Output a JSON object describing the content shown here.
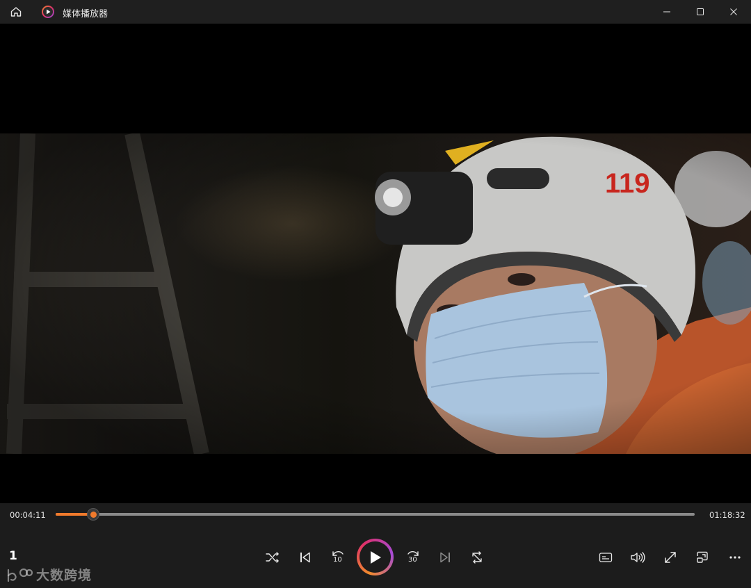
{
  "window": {
    "title": "媒体播放器",
    "home_icon": "home-icon",
    "app_icon": "media-player-icon",
    "minimize_icon": "minimize-icon",
    "maximize_icon": "maximize-icon",
    "close_icon": "close-icon"
  },
  "video": {
    "description_icon": "video-frame"
  },
  "playback": {
    "current_time": "00:04:11",
    "total_time": "01:18:32",
    "progress": 0.0589
  },
  "controls": {
    "shuffle_icon": "shuffle-icon",
    "previous_icon": "previous-track-icon",
    "rewind_label": "10",
    "play_icon": "play-icon",
    "forward_label": "30",
    "next_icon": "next-track-icon",
    "repeat_icon": "repeat-icon",
    "subtitles_icon": "subtitles-icon",
    "volume_icon": "volume-icon",
    "fullscreen_icon": "fullscreen-icon",
    "miniplayer_icon": "miniplayer-icon",
    "more_icon": "more-icon"
  },
  "overlay": {
    "page_number": "1",
    "watermark_text": "大数跨境"
  },
  "colors": {
    "accent": "#f07a2c",
    "background": "#1c1c1c"
  }
}
